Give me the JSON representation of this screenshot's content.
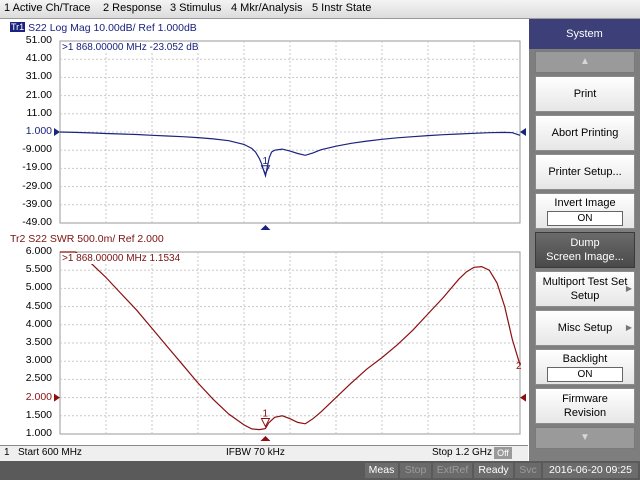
{
  "menu": [
    "1 Active Ch/Trace",
    "2 Response",
    "3 Stimulus",
    "4 Mkr/Analysis",
    "5 Instr State"
  ],
  "trace1": {
    "tag": "Tr1",
    "header": "S22  Log Mag 10.00dB/ Ref 1.000dB",
    "marker_readout": ">1  868.00000 MHz -23.052 dB",
    "y_ticks": [
      "51.00",
      "41.00",
      "31.00",
      "21.00",
      "11.00",
      "1.000",
      "-9.000",
      "-19.00",
      "-29.00",
      "-39.00",
      "-49.00"
    ],
    "ref_index": 5,
    "line_color": "#1a237e",
    "marker_label": "1"
  },
  "trace2": {
    "header": "Tr2  S22  SWR 500.0m/ Ref 2.000",
    "marker_readout": ">1  868.00000 MHz   1.1534",
    "y_ticks": [
      "6.000",
      "5.500",
      "5.000",
      "4.500",
      "4.000",
      "3.500",
      "3.000",
      "2.500",
      "2.000",
      "1.500",
      "1.000"
    ],
    "ref_index": 8,
    "line_color": "#8b1010",
    "marker_label": "1",
    "trace_end_label": "2"
  },
  "chart_data": [
    {
      "type": "line",
      "title": "S22  Log Mag 10.00dB/ Ref 1.000dB",
      "x": [
        600,
        620,
        640,
        660,
        680,
        700,
        720,
        740,
        760,
        780,
        800,
        820,
        840,
        850,
        855,
        860,
        863,
        866,
        868,
        870,
        873,
        876,
        880,
        890,
        900,
        910,
        920,
        930,
        940,
        960,
        980,
        1000,
        1020,
        1040,
        1060,
        1080,
        1100,
        1120,
        1140,
        1160,
        1180,
        1190,
        1200
      ],
      "series": [
        {
          "values": [
            1.0,
            0.8,
            0.5,
            0.2,
            -0.1,
            -0.4,
            -0.8,
            -1.2,
            -1.6,
            -2.1,
            -2.8,
            -3.8,
            -5.8,
            -8.0,
            -10.0,
            -13.5,
            -16.5,
            -20.5,
            -23.05,
            -19.0,
            -13.0,
            -10.0,
            -9.0,
            -8.4,
            -9.5,
            -10.8,
            -11.8,
            -10.5,
            -8.8,
            -6.8,
            -5.2,
            -4.0,
            -3.0,
            -2.2,
            -1.6,
            -1.0,
            -0.5,
            -0.1,
            0.3,
            0.6,
            0.8,
            0.6,
            -0.8
          ]
        }
      ],
      "xlim": [
        600,
        1200
      ],
      "ylim": [
        -49,
        51
      ]
    },
    {
      "type": "line",
      "title": "S22  SWR 500.0m/ Ref 2.000",
      "x": [
        600,
        620,
        640,
        660,
        680,
        700,
        720,
        740,
        760,
        780,
        800,
        820,
        840,
        850,
        860,
        866,
        868,
        872,
        880,
        890,
        900,
        910,
        920,
        930,
        940,
        960,
        980,
        1000,
        1020,
        1040,
        1060,
        1080,
        1100,
        1110,
        1120,
        1130,
        1140,
        1150,
        1160,
        1170,
        1180,
        1190,
        1200
      ],
      "series": [
        {
          "values": [
            6.4,
            6.1,
            5.7,
            5.3,
            4.85,
            4.4,
            3.9,
            3.4,
            2.9,
            2.4,
            1.95,
            1.55,
            1.25,
            1.14,
            1.12,
            1.14,
            1.15,
            1.3,
            1.46,
            1.5,
            1.42,
            1.32,
            1.28,
            1.42,
            1.6,
            2.0,
            2.4,
            2.78,
            3.1,
            3.45,
            3.85,
            4.3,
            4.75,
            5.0,
            5.25,
            5.45,
            5.58,
            5.6,
            5.5,
            5.15,
            4.5,
            3.6,
            2.9
          ]
        }
      ],
      "xlim": [
        600,
        1200
      ],
      "ylim": [
        1.0,
        6.0
      ]
    }
  ],
  "stim": {
    "channel": "1",
    "start": "Start 600 MHz",
    "ifbw": "IFBW 70 kHz",
    "stop": "Stop 1.2 GHz",
    "off": "Off"
  },
  "status": {
    "meas": "Meas",
    "stop": "Stop",
    "extref": "ExtRef",
    "ready": "Ready",
    "svc": "Svc",
    "datetime": "2016-06-20 09:25"
  },
  "softkeys": {
    "title": "System",
    "print": "Print",
    "abort": "Abort Printing",
    "printer_setup": "Printer Setup...",
    "invert_image": "Invert Image",
    "invert_state": "ON",
    "dump_line1": "Dump",
    "dump_line2": "Screen Image...",
    "multiport_line1": "Multiport Test Set",
    "multiport_line2": "Setup",
    "misc_setup": "Misc Setup",
    "backlight": "Backlight",
    "backlight_state": "ON",
    "firmware_line1": "Firmware",
    "firmware_line2": "Revision"
  },
  "colors": {
    "trace1": "#1a237e",
    "trace2": "#8b1010",
    "title_bg": "#3c3f78"
  }
}
